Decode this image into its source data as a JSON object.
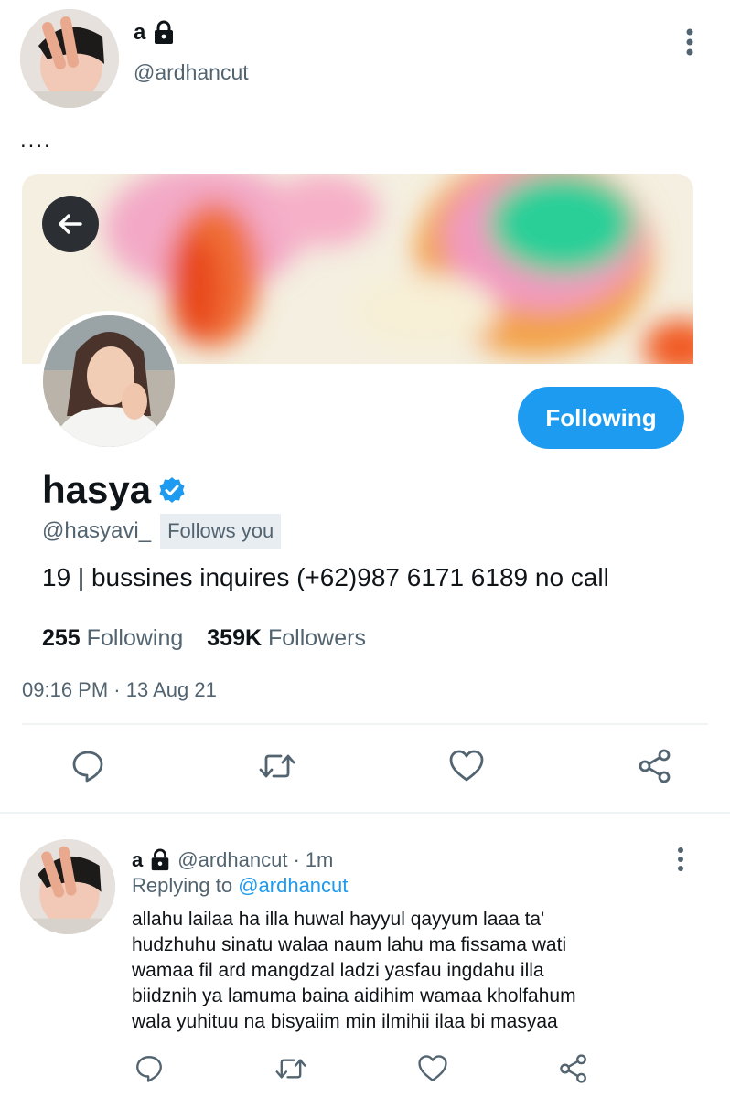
{
  "tweet": {
    "author_name": "a",
    "author_handle": "@ardhancut",
    "text": "....",
    "timestamp": "09:16 PM",
    "date": "13 Aug 21"
  },
  "profile_card": {
    "display_name": "hasya",
    "handle": "@hasyavi_",
    "follows_you": "Follows you",
    "bio": "19 | bussines inquires (+62)987 6171 6189 no call",
    "following_count": "255",
    "following_label": "Following",
    "followers_count": "359K",
    "followers_label": "Followers",
    "follow_button_label": "Following"
  },
  "reply": {
    "author_name": "a",
    "author_handle": "@ardhancut",
    "time": "1m",
    "replying_to_label": "Replying to",
    "replying_to_handle": "@ardhancut",
    "text_lines": [
      "allahu lailaa ha illa huwal hayyul qayyum laaa ta'",
      "hudzhuhu sinatu walaa naum lahu ma fissama wati",
      "wamaa fil ard mangdzal ladzi yasfau ingdahu illa",
      "biidznih ya lamuma baina aidihim wamaa kholfahum",
      "wala yuhituu na bisyaiim min ilmihii ilaa bi masyaa"
    ]
  },
  "colors": {
    "accent": "#1d9bf0",
    "secondary_text": "#536471",
    "primary_text": "#0f1419"
  },
  "icons": {
    "lock": "lock-icon",
    "verified": "verified-badge-icon",
    "back": "back-arrow-icon",
    "reply": "reply-icon",
    "retweet": "retweet-icon",
    "like": "like-icon",
    "share": "share-icon",
    "more": "more-vertical-icon"
  }
}
